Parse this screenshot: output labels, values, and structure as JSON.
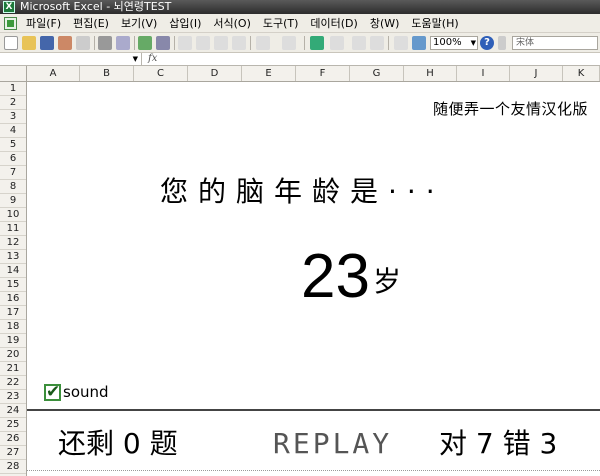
{
  "window": {
    "app_icon_label": "X",
    "title": "Microsoft Excel - 뇌연령TEST"
  },
  "menu": [
    "파일(F)",
    "편집(E)",
    "보기(V)",
    "삽입(I)",
    "서식(O)",
    "도구(T)",
    "데이터(D)",
    "창(W)",
    "도움말(H)"
  ],
  "toolbar": {
    "zoom": "100%",
    "font": "宋体",
    "help": "?"
  },
  "formula": {
    "fx": "fx"
  },
  "columns": [
    "A",
    "B",
    "C",
    "D",
    "E",
    "F",
    "G",
    "H",
    "I",
    "J",
    "K"
  ],
  "rows": [
    "1",
    "2",
    "3",
    "4",
    "5",
    "6",
    "7",
    "8",
    "9",
    "10",
    "11",
    "12",
    "13",
    "14",
    "15",
    "16",
    "17",
    "18",
    "19",
    "20",
    "21",
    "22",
    "23",
    "24",
    "25",
    "26",
    "27",
    "28"
  ],
  "sheet": {
    "subtitle": "随便弄一个友情汉化版",
    "question": "您的脑年龄是···",
    "age": "23",
    "age_unit": "岁",
    "sound_label": "sound",
    "remaining": "还剩 0 题",
    "replay": "REPLAY",
    "score": "对 7  错 3"
  },
  "colors": {
    "accent_green": "#3b8f3b",
    "grid_line": "#d6d3cb",
    "header_bg": "#f3f1ec"
  }
}
